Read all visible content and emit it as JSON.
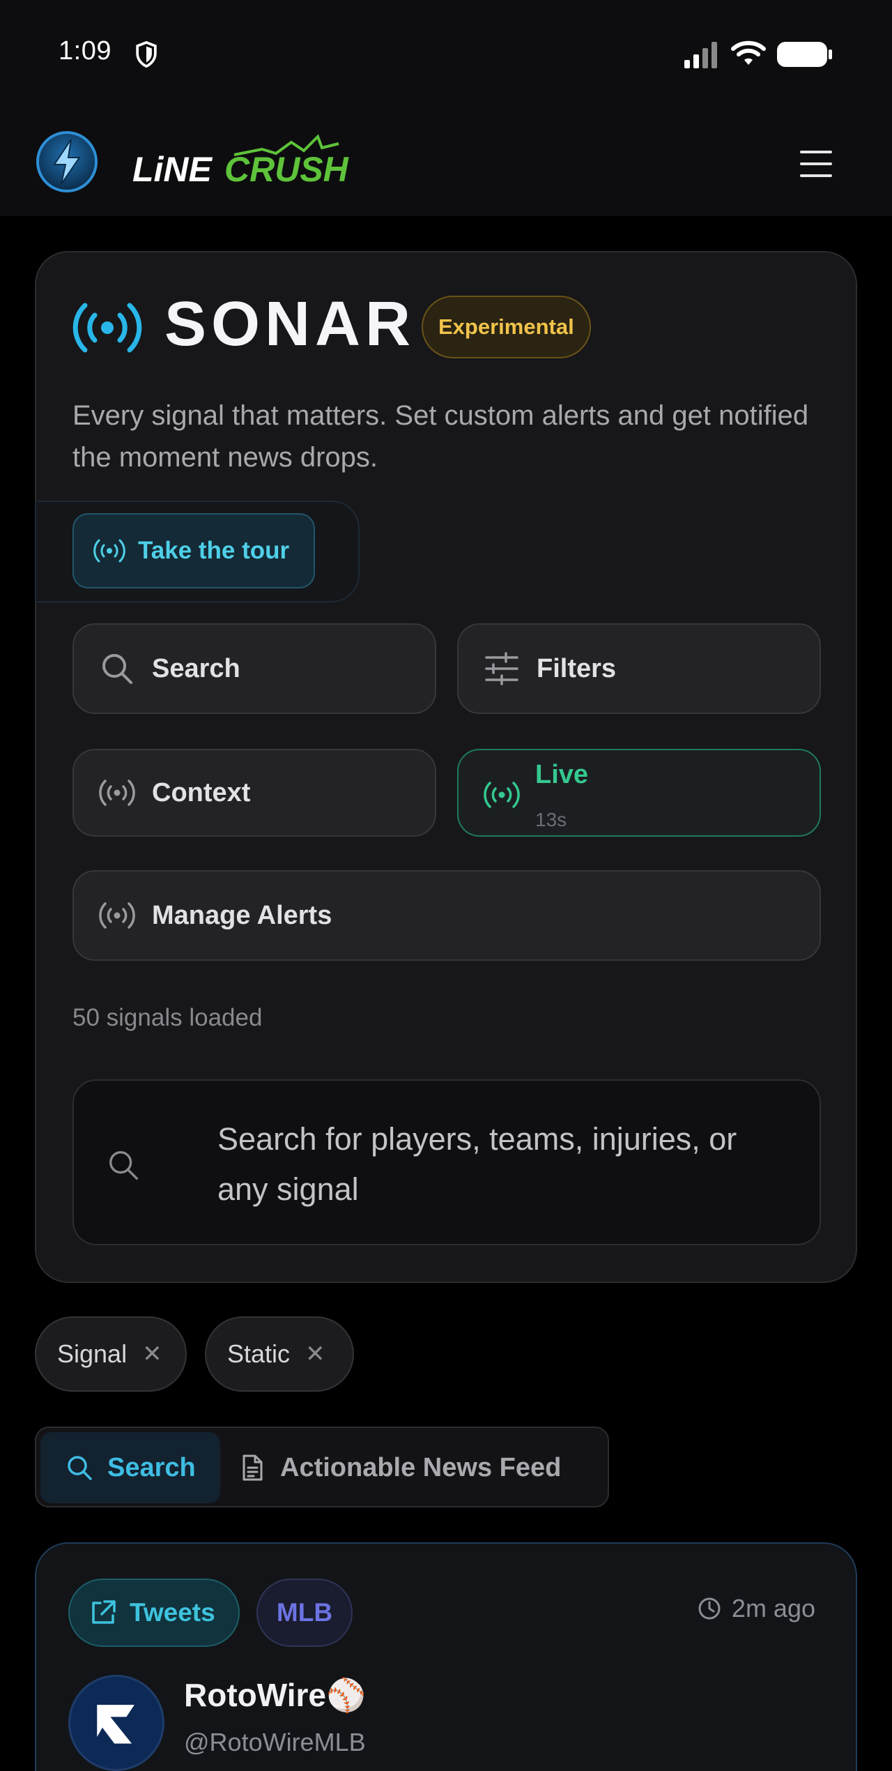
{
  "status_bar": {
    "time": "1:09",
    "icons": [
      "shield-icon",
      "cellular-signal-icon",
      "wifi-icon",
      "battery-icon"
    ]
  },
  "nav": {
    "brand_icon": "lightning-bolt-icon",
    "logo_text": "LiNECRUSH",
    "menu_icon": "hamburger-menu-icon"
  },
  "hero": {
    "icon": "broadcast-signal-icon",
    "title": "SONAR",
    "badge": "Experimental",
    "description": "Every signal that matters. Set custom alerts and get notified the moment news drops.",
    "tour_label": "Take the tour",
    "buttons": {
      "search": "Search",
      "filters": "Filters",
      "context": "Context",
      "live": "Live",
      "live_sub": "13s",
      "manage_alerts": "Manage Alerts"
    },
    "signals_loaded": "50 signals loaded",
    "search_placeholder": "Search for players, teams, injuries, or any signal"
  },
  "chips": [
    {
      "label": "Signal",
      "remove": "✕"
    },
    {
      "label": "Static",
      "remove": "✕"
    }
  ],
  "tabs": [
    {
      "label": "Search",
      "icon": "search-icon",
      "active": true
    },
    {
      "label": "Actionable News Feed",
      "icon": "document-icon",
      "active": false
    }
  ],
  "feed": {
    "tags": [
      "Tweets",
      "MLB"
    ],
    "time": "2m ago",
    "author": {
      "name": "RotoWire⚾",
      "handle": "@RotoWireMLB"
    }
  },
  "colors": {
    "accent_cyan": "#3fbde4",
    "live_green": "#35c98f",
    "badge_gold": "#f1c34b",
    "mlb_purple": "#6c73e3",
    "logo_green": "#5ec33a"
  }
}
